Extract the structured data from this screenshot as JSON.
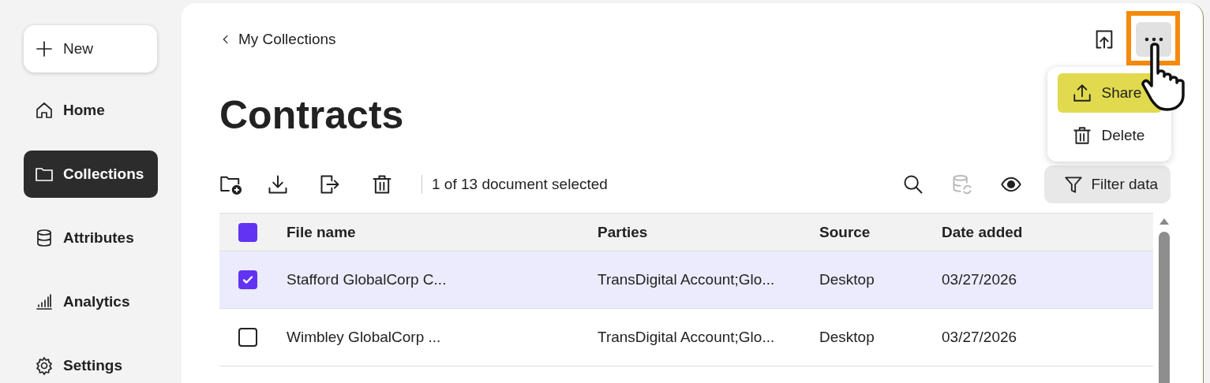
{
  "sidebar": {
    "new_button": {
      "label": "New"
    },
    "items": [
      {
        "label": "Home",
        "selected": false
      },
      {
        "label": "Collections",
        "selected": true
      },
      {
        "label": "Attributes",
        "selected": false
      },
      {
        "label": "Analytics",
        "selected": false
      },
      {
        "label": "Settings",
        "selected": false
      }
    ]
  },
  "header": {
    "back_link": "My Collections",
    "more_button": {
      "highlighted": true
    }
  },
  "menu": {
    "items": [
      {
        "label": "Share",
        "selected": true
      },
      {
        "label": "Delete",
        "selected": false
      }
    ]
  },
  "title": "Contracts",
  "toolbar": {
    "selection_text": "1 of 13 document selected",
    "right_tools": [
      {
        "disabled": false
      },
      {
        "disabled": true
      },
      {
        "disabled": false
      }
    ],
    "filter_button": "Filter data"
  },
  "table": {
    "header_checkbox": {
      "checked": true
    },
    "columns": [
      "File name",
      "Parties",
      "Source",
      "Date added"
    ],
    "rows": [
      {
        "selected": true,
        "checked": true,
        "cells": [
          "Stafford GlobalCorp C...",
          "TransDigital Account;Glo...",
          "Desktop",
          "03/27/2026"
        ]
      },
      {
        "selected": false,
        "checked": false,
        "cells": [
          "Wimbley GlobalCorp ...",
          "TransDigital Account;Glo...",
          "Desktop",
          "03/27/2026"
        ]
      }
    ]
  }
}
